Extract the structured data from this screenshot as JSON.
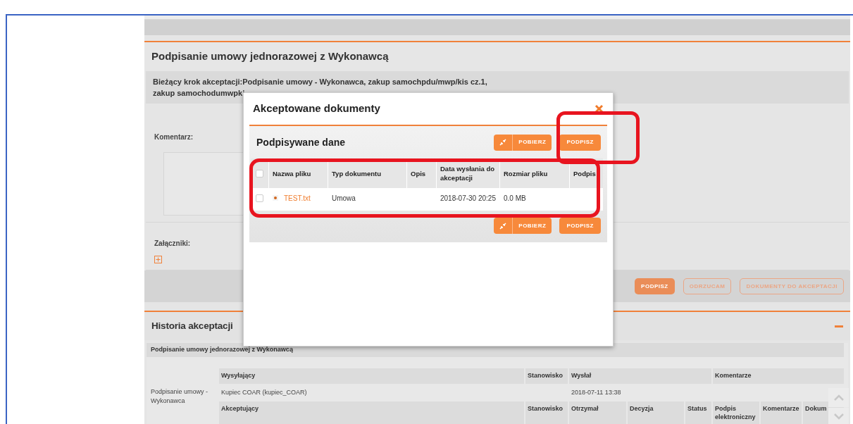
{
  "section": {
    "title": "Podpisanie umowy jednorazowej z Wykonawcą",
    "step_lines": [
      "Bieżący krok akceptacji:Podpisanie umowy - Wykonawca, zakup samochpdu/mwp/kis cz.1,",
      "zakup samochodumwpki"
    ],
    "comment_label": "Komentarz:",
    "attachments_label": "Załączniki:"
  },
  "actions": [
    {
      "kind": "primary",
      "label": "PODPISZ"
    },
    {
      "kind": "outline",
      "label": "ODRZUCAM"
    },
    {
      "kind": "outline",
      "label": "DOKUMENTY DO AKCEPTACJI"
    }
  ],
  "history": {
    "title": "Historia akceptacji",
    "expanded": true,
    "group_title": "Podpisanie umowy jednorazowej z Wykonawcą",
    "step": "Podpisanie umowy - Wykonawca",
    "sender_columns": [
      "Wysyłający",
      "Stanowisko",
      "Wysłał",
      "Komentarze"
    ],
    "sender_row": {
      "sender": "Kupiec COAR (kupiec_COAR)",
      "sent": "2018-07-11 13:38"
    },
    "acceptor_columns": [
      "Akceptujący",
      "Stanowisko",
      "Otrzymał",
      "Decyzja",
      "Status",
      "Podpis elektroniczny",
      "Komentarze",
      "Dokum"
    ]
  },
  "modal": {
    "title": "Akceptowane dokumenty",
    "panel_title": "Podpisywane dane",
    "buttons": [
      {
        "kind": "download",
        "label": "POBIERZ"
      },
      {
        "kind": "sign",
        "label": "PODPISZ"
      }
    ],
    "bottom_buttons": [
      {
        "kind": "download",
        "label": "POBIERZ"
      },
      {
        "kind": "sign",
        "label": "PODPISZ"
      }
    ],
    "columns": [
      "Nazwa pliku",
      "Typ dokumentu",
      "Opis",
      "Data wysłania do akceptacji",
      "Rozmiar pliku",
      "Podpis"
    ],
    "all_checked": false,
    "rows": [
      {
        "checked": false,
        "file": "TEST.txt",
        "type": "Umowa",
        "sent": "2018-07-30 20:25",
        "size": "0.0 MB"
      }
    ]
  }
}
